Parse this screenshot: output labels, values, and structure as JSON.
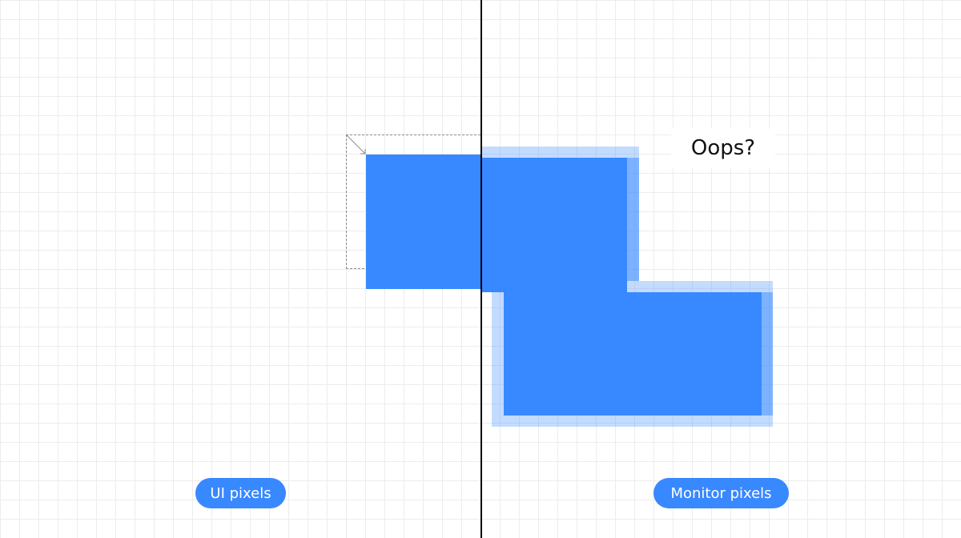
{
  "annotation": {
    "oops_text": "Oops?"
  },
  "labels": {
    "ui_pixels": "UI pixels",
    "monitor_pixels": "Monitor pixels"
  },
  "colors": {
    "shape_fill": "#3888ff",
    "divider": "#000000",
    "grid_line": "#ececec",
    "dashed_outline": "#8c8c8c"
  },
  "icons": {
    "offset_arrow": "diagonal-arrow-icon"
  }
}
